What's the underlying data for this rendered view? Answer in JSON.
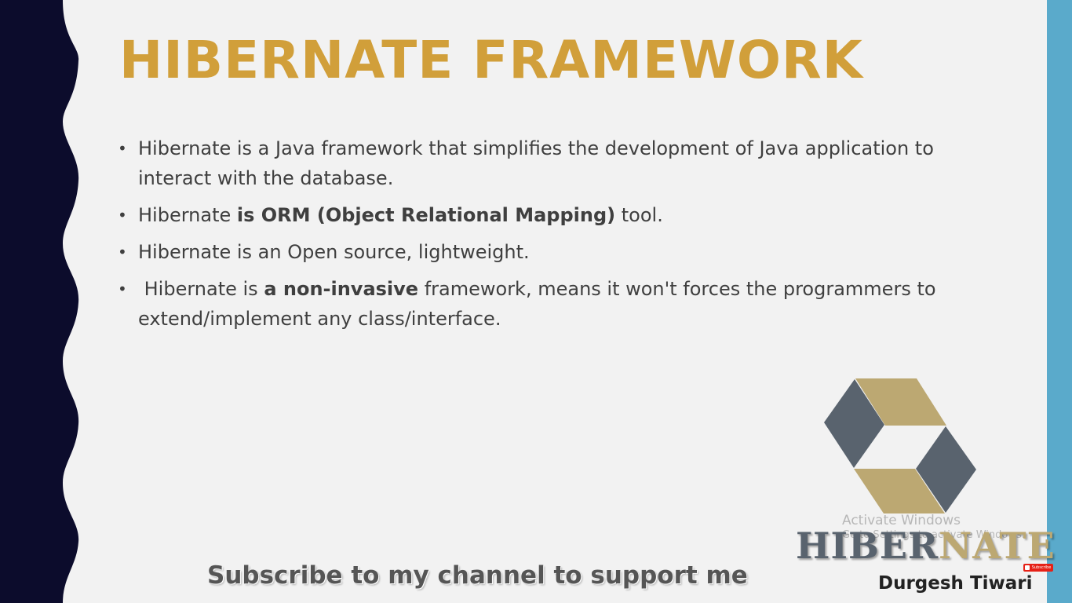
{
  "slide": {
    "title": "HIBERNATE FRAMEWORK",
    "bullets": [
      {
        "t1": "Hibernate is a Java framework that simplifies the development of Java application to interact with the database."
      },
      {
        "t1": "Hibernate ",
        "bold": "is ORM (Object Relational Mapping)",
        "t2": " tool."
      },
      {
        "t1": "Hibernate is an Open source, lightweight."
      },
      {
        "t1": " Hibernate is ",
        "bold": "a non-invasive",
        "t2": " framework, means it won't forces the programmers to extend/implement any class/interface."
      }
    ],
    "bullet_glyph": "•"
  },
  "logo": {
    "text_part1": "HIBER",
    "text_part2": "NATE",
    "icon": "hibernate-logo-icon"
  },
  "overlay": {
    "subscribe_text": "Subscribe to my channel to support me",
    "author": "Durgesh Tiwari",
    "youtube_badge": "Subscribe"
  },
  "watermark": {
    "line1": "Activate Windows",
    "line2": "Go to Settings to activate Windows."
  },
  "colors": {
    "title": "#d19f3a",
    "left_wave": "#0c0c2c",
    "right_bar": "#5aaacb",
    "background": "#f2f2f2",
    "logo_gold": "#bca872",
    "logo_slate": "#59636e"
  }
}
